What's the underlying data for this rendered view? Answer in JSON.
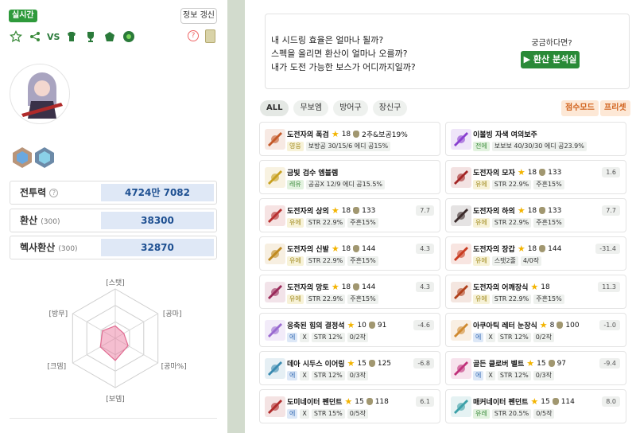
{
  "left": {
    "live_badge": "실시간",
    "refresh_button": "정보 갱신",
    "vs_label": "VS",
    "help_symbol": "?",
    "stats": [
      {
        "label": "전투력",
        "sub": "",
        "value": "4724만 7082",
        "has_help": true
      },
      {
        "label": "환산",
        "sub": "(300)",
        "value": "38300",
        "has_help": false
      },
      {
        "label": "헥사환산",
        "sub": "(300)",
        "value": "32870",
        "has_help": false
      }
    ],
    "radar_labels": [
      "[스탯]",
      "[공마]",
      "[공마%]",
      "[보뎀]",
      "[크뎀]",
      "[방무]"
    ],
    "radar_values": [
      0.25,
      0.2,
      0.3,
      0.45,
      0.35,
      0.3
    ],
    "colors": {
      "accent": "#2e9a3b",
      "stat_value_bg": "#dfe8f6",
      "stat_value_text": "#1d4f91"
    }
  },
  "info": {
    "questions": [
      "내 시드링 효율은 얼마나 될까?",
      "스펙을 올리면 환산이 얼마나 오를까?",
      "내가 도전 가능한 보스가 어디까지일까?"
    ],
    "curious": "궁금하다면?",
    "analyze_button": "환산 분석실"
  },
  "filter_tabs": [
    "ALL",
    "무보엠",
    "방어구",
    "장신구"
  ],
  "modes": {
    "score_mode": "점수모드",
    "preset": "프리셋"
  },
  "items": [
    {
      "name": "도전자의 폭검",
      "stars": "18",
      "upgrade": "2추&보공19%",
      "grade": "영웅",
      "grade_cls": "",
      "stats": [
        "보방공 30/15/6 에디 공15%"
      ],
      "delta": "",
      "color": "#c45a2a"
    },
    {
      "name": "이볼빙 자색 여의보주",
      "stars": "",
      "upgrade": "",
      "grade": "전에",
      "grade_cls": "green",
      "stats": [
        "보보보 40/30/30 에디 공23.9%"
      ],
      "delta": "",
      "color": "#8a3fd0"
    },
    {
      "name": "금빛 검수 엠블렘",
      "stars": "",
      "upgrade": "",
      "grade": "레유",
      "grade_cls": "green",
      "stats": [
        "공공X 12/9 에디 공15.5%"
      ],
      "delta": "",
      "color": "#c8a020"
    },
    {
      "name": "도전자의 모자",
      "stars": "18",
      "upgrade": "133",
      "grade": "유에",
      "grade_cls": "",
      "stats": [
        "STR 22.9%",
        "주흔15%"
      ],
      "delta": "1.6",
      "color": "#a32424"
    },
    {
      "name": "도전자의 상의",
      "stars": "18",
      "upgrade": "133",
      "grade": "유에",
      "grade_cls": "",
      "stats": [
        "STR 22.9%",
        "주흔15%"
      ],
      "delta": "7.7",
      "color": "#b83030"
    },
    {
      "name": "도전자의 하의",
      "stars": "18",
      "upgrade": "133",
      "grade": "유에",
      "grade_cls": "",
      "stats": [
        "STR 22.9%",
        "주흔15%"
      ],
      "delta": "7.7",
      "color": "#3a2a2a"
    },
    {
      "name": "도전자의 신발",
      "stars": "18",
      "upgrade": "144",
      "grade": "유에",
      "grade_cls": "",
      "stats": [
        "STR 22.9%",
        "주흔15%"
      ],
      "delta": "4.3",
      "color": "#c08a20"
    },
    {
      "name": "도전자의 장갑",
      "stars": "18",
      "upgrade": "144",
      "grade": "유에",
      "grade_cls": "",
      "stats": [
        "스탯2줄",
        "4/0작"
      ],
      "delta": "-31.4",
      "color": "#c83a20"
    },
    {
      "name": "도전자의 망토",
      "stars": "18",
      "upgrade": "144",
      "grade": "유에",
      "grade_cls": "",
      "stats": [
        "STR 22.9%",
        "주흔15%"
      ],
      "delta": "4.3",
      "color": "#9a2a5a"
    },
    {
      "name": "도전자의 어깨장식",
      "stars": "18",
      "upgrade": "",
      "grade": "유에",
      "grade_cls": "",
      "stats": [
        "STR 22.9%",
        "주흔15%"
      ],
      "delta": "11.3",
      "color": "#b0401a"
    },
    {
      "name": "응축된 힘의 결정석",
      "stars": "10",
      "upgrade": "91",
      "grade": "에",
      "grade_cls": "blue",
      "stats": [
        "X",
        "STR 12%",
        "0/2작"
      ],
      "delta": "-4.6",
      "color": "#9a6ad0"
    },
    {
      "name": "아쿠아틱 레터 눈장식",
      "stars": "8",
      "upgrade": "100",
      "grade": "에",
      "grade_cls": "blue",
      "stats": [
        "X",
        "STR 12%",
        "0/2작"
      ],
      "delta": "-1.0",
      "color": "#d08a30"
    },
    {
      "name": "데아 시두스 이어링",
      "stars": "15",
      "upgrade": "125",
      "grade": "에",
      "grade_cls": "blue",
      "stats": [
        "X",
        "STR 12%",
        "0/3작"
      ],
      "delta": "-6.8",
      "color": "#3a8ab0"
    },
    {
      "name": "골든 클로버 벨트",
      "stars": "15",
      "upgrade": "97",
      "grade": "에",
      "grade_cls": "blue",
      "stats": [
        "X",
        "STR 12%",
        "0/3작"
      ],
      "delta": "-9.4",
      "color": "#c0307a"
    },
    {
      "name": "도미네이터 펜던트",
      "stars": "15",
      "upgrade": "118",
      "grade": "에",
      "grade_cls": "blue",
      "stats": [
        "X",
        "STR 15%",
        "0/5작"
      ],
      "delta": "6.1",
      "color": "#b02a2a"
    },
    {
      "name": "매커네이터 펜던트",
      "stars": "15",
      "upgrade": "114",
      "grade": "유레",
      "grade_cls": "green",
      "stats": [
        "STR 20.5%",
        "0/5작"
      ],
      "delta": "8.0",
      "color": "#3aa0a8"
    }
  ]
}
